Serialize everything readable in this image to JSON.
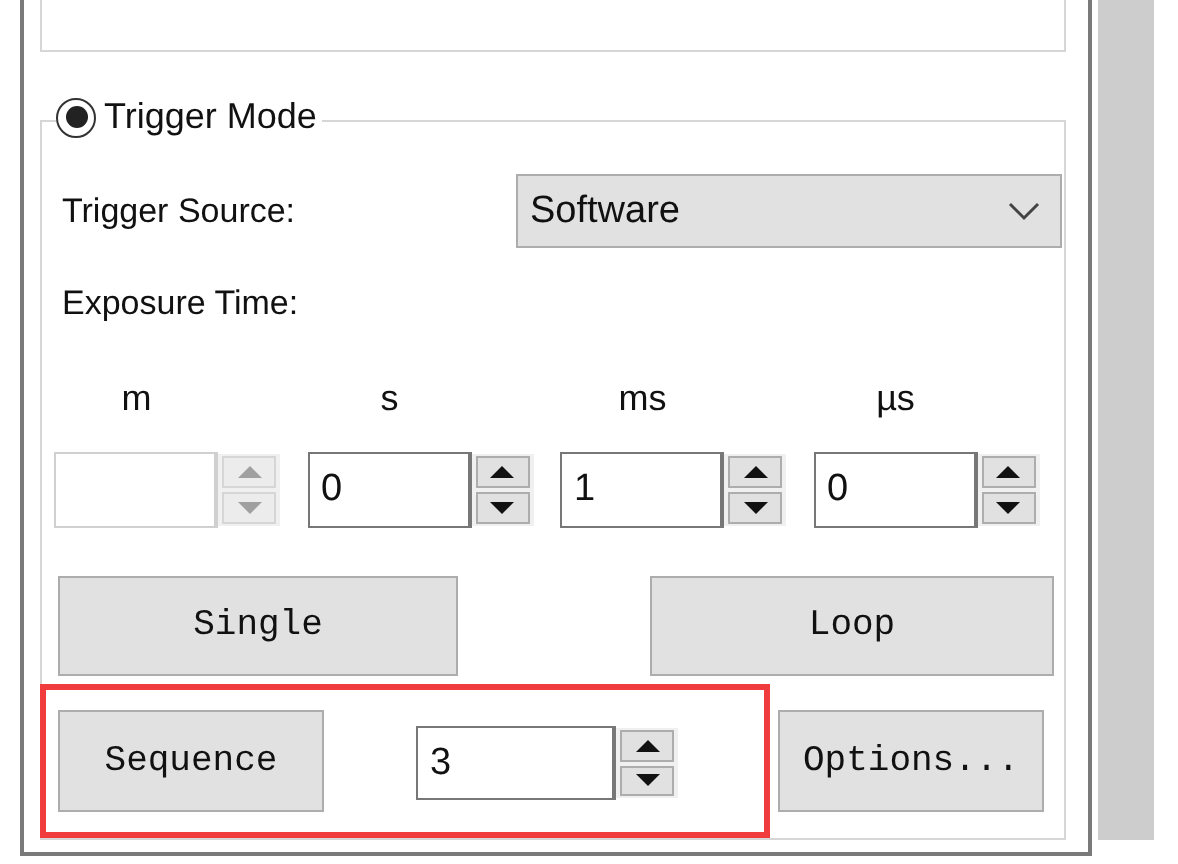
{
  "trigger_mode": {
    "label": "Trigger Mode",
    "selected": true
  },
  "trigger_source": {
    "label": "Trigger Source:",
    "value": "Software"
  },
  "exposure": {
    "label": "Exposure Time:",
    "fields": [
      {
        "unit": "m",
        "disabled": true
      },
      {
        "unit": "s",
        "value": "0",
        "disabled": false
      },
      {
        "unit": "ms",
        "value": "1",
        "disabled": false
      },
      {
        "unit": "µs",
        "value": "0",
        "disabled": false
      }
    ]
  },
  "buttons": [
    {
      "label": "Single"
    },
    {
      "label": "Loop"
    }
  ],
  "sequence": {
    "button": "Sequence",
    "value": "3",
    "highlighted": true
  },
  "options_button": "Options..."
}
